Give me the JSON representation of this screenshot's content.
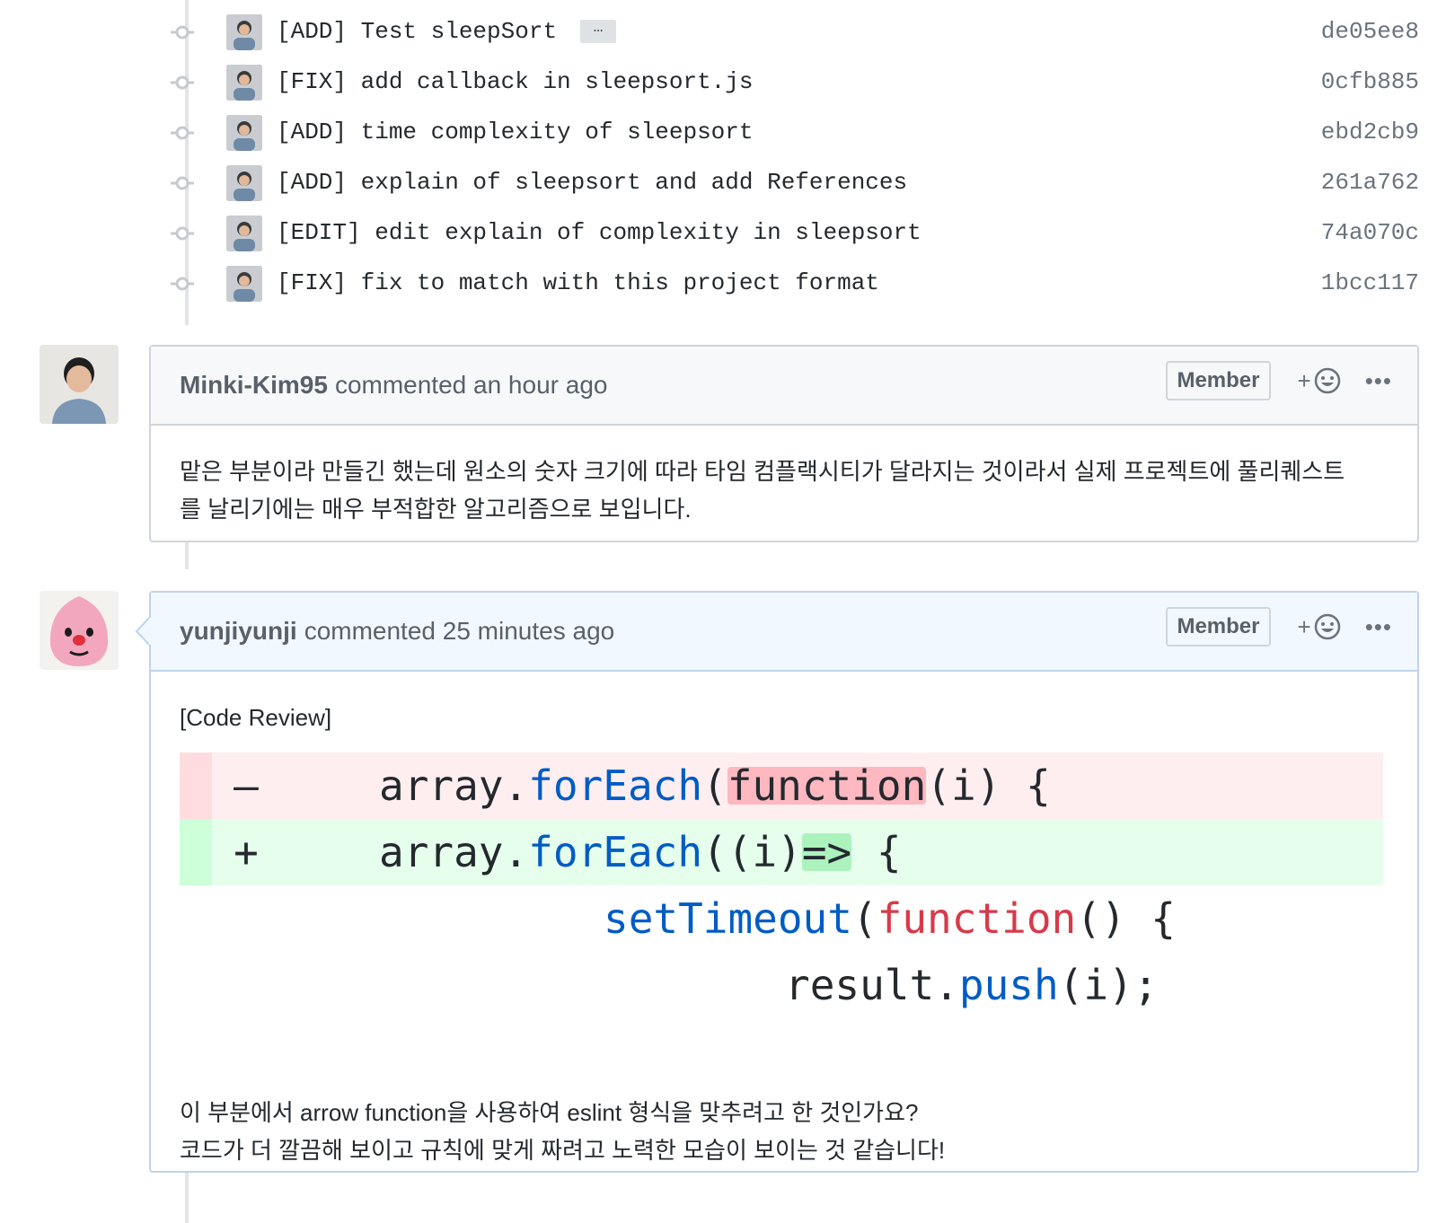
{
  "commits": [
    {
      "message": "[ADD] Test sleepSort",
      "sha": "de05ee8",
      "has_ellipsis": true
    },
    {
      "message": "[FIX] add callback in sleepsort.js",
      "sha": "0cfb885"
    },
    {
      "message": "[ADD] time complexity of sleepsort",
      "sha": "ebd2cb9"
    },
    {
      "message": "[ADD] explain of sleepsort and add References",
      "sha": "261a762"
    },
    {
      "message": "[EDIT] edit explain of complexity in sleepsort",
      "sha": "74a070c"
    },
    {
      "message": "[FIX] fix to match with this project format",
      "sha": "1bcc117"
    }
  ],
  "ellipsis_label": "…",
  "comments": [
    {
      "author": "Minki-Kim95",
      "meta": "commented an hour ago",
      "badge": "Member",
      "react_plus": "+",
      "more": "•••",
      "body_lines": [
        "맡은 부분이라 만들긴 했는데 원소의 숫자 크기에 따라 타임 컴플랙시티가 달라지는 것이라서 실제 프로젝트에 풀리퀘스트",
        "를 날리기에는 매우 부적합한 알고리즘으로 보입니다."
      ]
    },
    {
      "author": "yunjiyunji",
      "meta": "commented 25 minutes ago",
      "badge": "Member",
      "react_plus": "+",
      "more": "•••",
      "intro": "[Code Review]",
      "diff": {
        "del_sign": "–",
        "add_sign": "+",
        "del_parts": [
          "array.",
          "forEach",
          "(",
          "function",
          "(i) {"
        ],
        "add_parts": [
          "array.",
          "forEach",
          "((i)",
          "=>",
          " {"
        ],
        "line3_parts": [
          "setTimeout",
          "(",
          "function",
          "() {"
        ],
        "line4_parts": [
          "result.",
          "push",
          "(i);"
        ]
      },
      "body_lines": [
        "이 부분에서 arrow function을 사용하여 eslint 형식을 맞추려고 한 것인가요?",
        "코드가 더 깔끔해 보이고 규칙에 맞게 짜려고 노력한 모습이 보이는 것 같습니다!"
      ]
    }
  ],
  "colors": {
    "keyword_blue": "#005cc5",
    "keyword_red": "#d73a49",
    "del_bg": "#ffeef0",
    "add_bg": "#e6ffed"
  }
}
